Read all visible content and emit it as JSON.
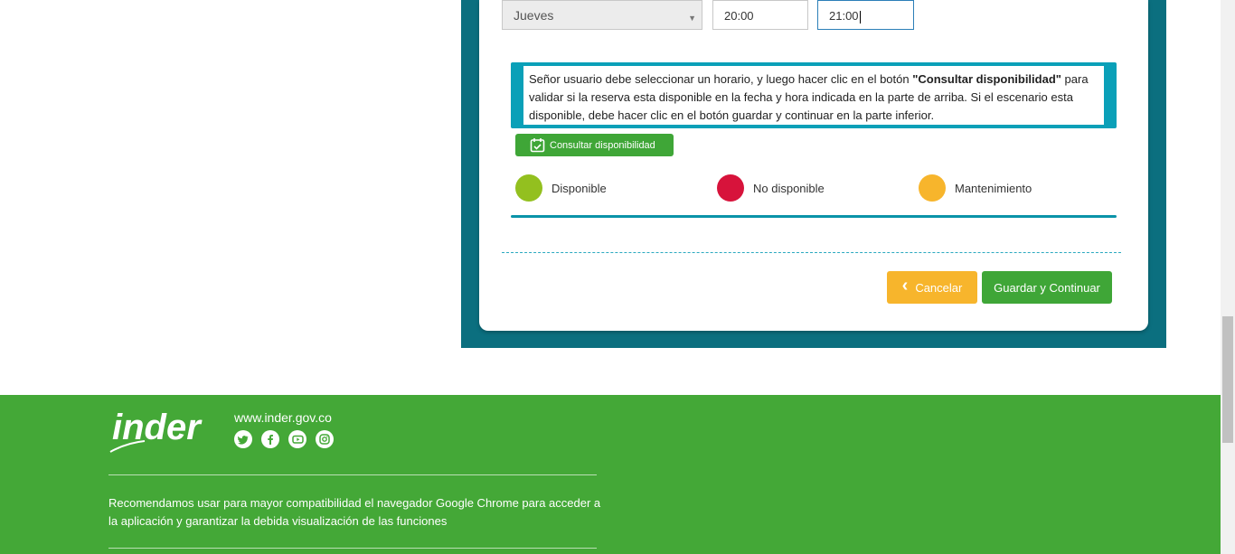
{
  "form": {
    "day_select": "Jueves",
    "time_start": "20:00",
    "time_end": "21:00"
  },
  "info": {
    "text_before": "Señor usuario debe seleccionar un horario, y luego hacer clic en el botón ",
    "text_bold": "\"Consultar disponibilidad\"",
    "text_after": " para validar si la reserva esta disponible en la fecha y hora indicada en la parte de arriba. Si el escenario esta disponible, debe hacer clic en el botón guardar y continuar en la parte inferior."
  },
  "check_button": {
    "label": "Consultar disponibilidad",
    "icon": "calendar-check-icon"
  },
  "legend": [
    {
      "label": "Disponible",
      "color": "#93c01f"
    },
    {
      "label": "No disponible",
      "color": "#d7133b"
    },
    {
      "label": "Mantenimiento",
      "color": "#f7b52c"
    }
  ],
  "actions": {
    "cancel_label": "Cancelar",
    "save_label": "Guardar y Continuar"
  },
  "footer": {
    "logo_text": "inder",
    "website": "www.inder.gov.co",
    "social": [
      "twitter-icon",
      "facebook-icon",
      "youtube-icon",
      "instagram-icon"
    ],
    "notice": "Recomendamos usar para mayor compatibilidad el navegador Google Chrome para acceder a la aplicación y garantizar la debida visualización de las funciones"
  },
  "colors": {
    "teal": "#0b6f7f",
    "green": "#44a837",
    "orange": "#f7b52c",
    "info_border": "#0aa0b8"
  }
}
